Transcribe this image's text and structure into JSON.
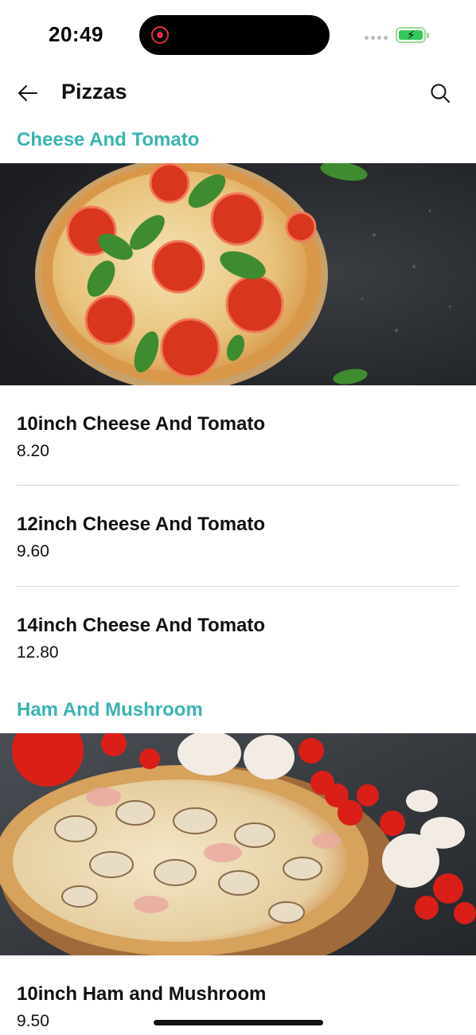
{
  "status_bar": {
    "time": "20:49",
    "recording_icon": "record-icon",
    "signal_icon": "cellular-signal-icon",
    "battery_icon": "battery-charging-icon",
    "battery_color": "#34c759"
  },
  "app_bar": {
    "title": "Pizzas",
    "back_icon": "arrow-left-icon",
    "search_icon": "search-icon"
  },
  "colors": {
    "section_title": "#3ab3b3",
    "divider": "#d6d6d6"
  },
  "sections": [
    {
      "title": "Cheese And Tomato",
      "image": "cheese-and-tomato-pizza-photo",
      "items": [
        {
          "name": "10inch Cheese And Tomato",
          "price": "8.20"
        },
        {
          "name": "12inch Cheese And Tomato",
          "price": "9.60"
        },
        {
          "name": "14inch Cheese And Tomato",
          "price": "12.80"
        }
      ]
    },
    {
      "title": "Ham And Mushroom",
      "image": "ham-and-mushroom-pizza-photo",
      "items": [
        {
          "name": "10inch Ham and Mushroom",
          "price": "9.50"
        }
      ]
    }
  ]
}
